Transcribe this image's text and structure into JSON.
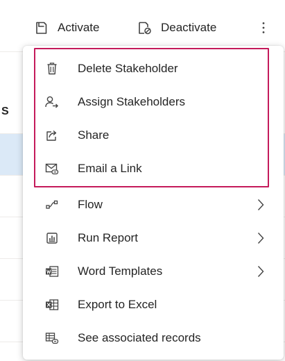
{
  "command_bar": {
    "activate": {
      "label": "Activate",
      "icon": "activate-icon"
    },
    "deactivate": {
      "label": "Deactivate",
      "icon": "deactivate-icon"
    },
    "more": {
      "icon": "more-vertical-icon"
    }
  },
  "background": {
    "partial_label": "S"
  },
  "menu": {
    "items": [
      {
        "label": "Delete Stakeholder",
        "icon": "delete-icon",
        "has_submenu": false,
        "highlighted": true
      },
      {
        "label": "Assign Stakeholders",
        "icon": "assign-person-icon",
        "has_submenu": false,
        "highlighted": true
      },
      {
        "label": "Share",
        "icon": "share-icon",
        "has_submenu": false,
        "highlighted": true
      },
      {
        "label": "Email a Link",
        "icon": "email-link-icon",
        "has_submenu": false,
        "highlighted": true
      },
      {
        "label": "Flow",
        "icon": "flow-icon",
        "has_submenu": true,
        "highlighted": false
      },
      {
        "label": "Run Report",
        "icon": "report-icon",
        "has_submenu": true,
        "highlighted": false
      },
      {
        "label": "Word Templates",
        "icon": "word-icon",
        "has_submenu": true,
        "highlighted": false
      },
      {
        "label": "Export to Excel",
        "icon": "excel-icon",
        "has_submenu": false,
        "highlighted": false
      },
      {
        "label": "See associated records",
        "icon": "associated-records-icon",
        "has_submenu": false,
        "highlighted": false
      }
    ]
  },
  "colors": {
    "highlight_border": "#c4195a",
    "text": "#242424",
    "selected_row": "#dbe9f7"
  }
}
